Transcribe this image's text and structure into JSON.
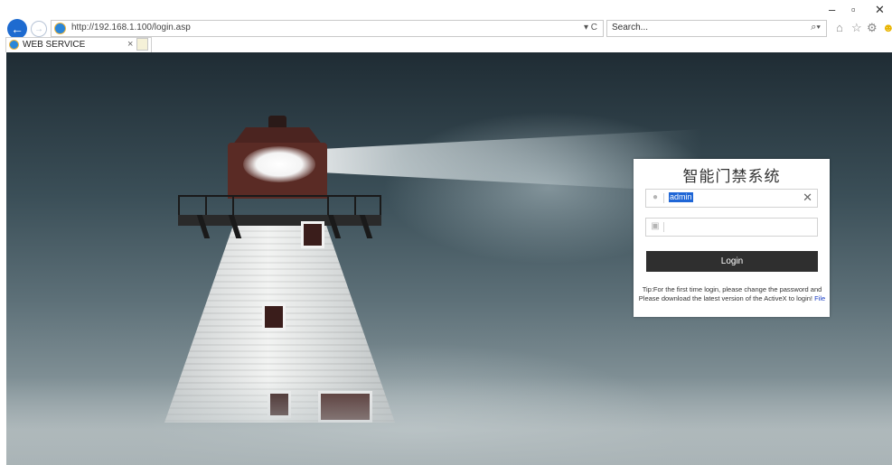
{
  "browser": {
    "url": "http://192.168.1.100/login.asp",
    "search_placeholder": "Search...",
    "tab_title": "WEB SERVICE",
    "tab_close": "×",
    "refresh_glyph": "▾ C",
    "window_controls": {
      "minimize": "–",
      "restore": "▫",
      "close": "✕"
    },
    "toolbar_icons": [
      "home-icon",
      "favorites-star-icon",
      "settings-gear-icon",
      "smiley-feedback-icon"
    ]
  },
  "login": {
    "title": "智能门禁系统",
    "username_value": "admin",
    "clear_glyph": "✕",
    "password_value": "",
    "button_label": "Login",
    "tip_line1": "Tip:For the first time login, please change the password and",
    "tip_line2_a": "Please download the latest version of the ActiveX to login!",
    "tip_link": "File"
  },
  "colors": {
    "login_button_bg": "#2f2f2f",
    "selection_highlight": "#1f66d6",
    "link": "#1b3fc4",
    "browser_back_button": "#1e6bd0"
  }
}
